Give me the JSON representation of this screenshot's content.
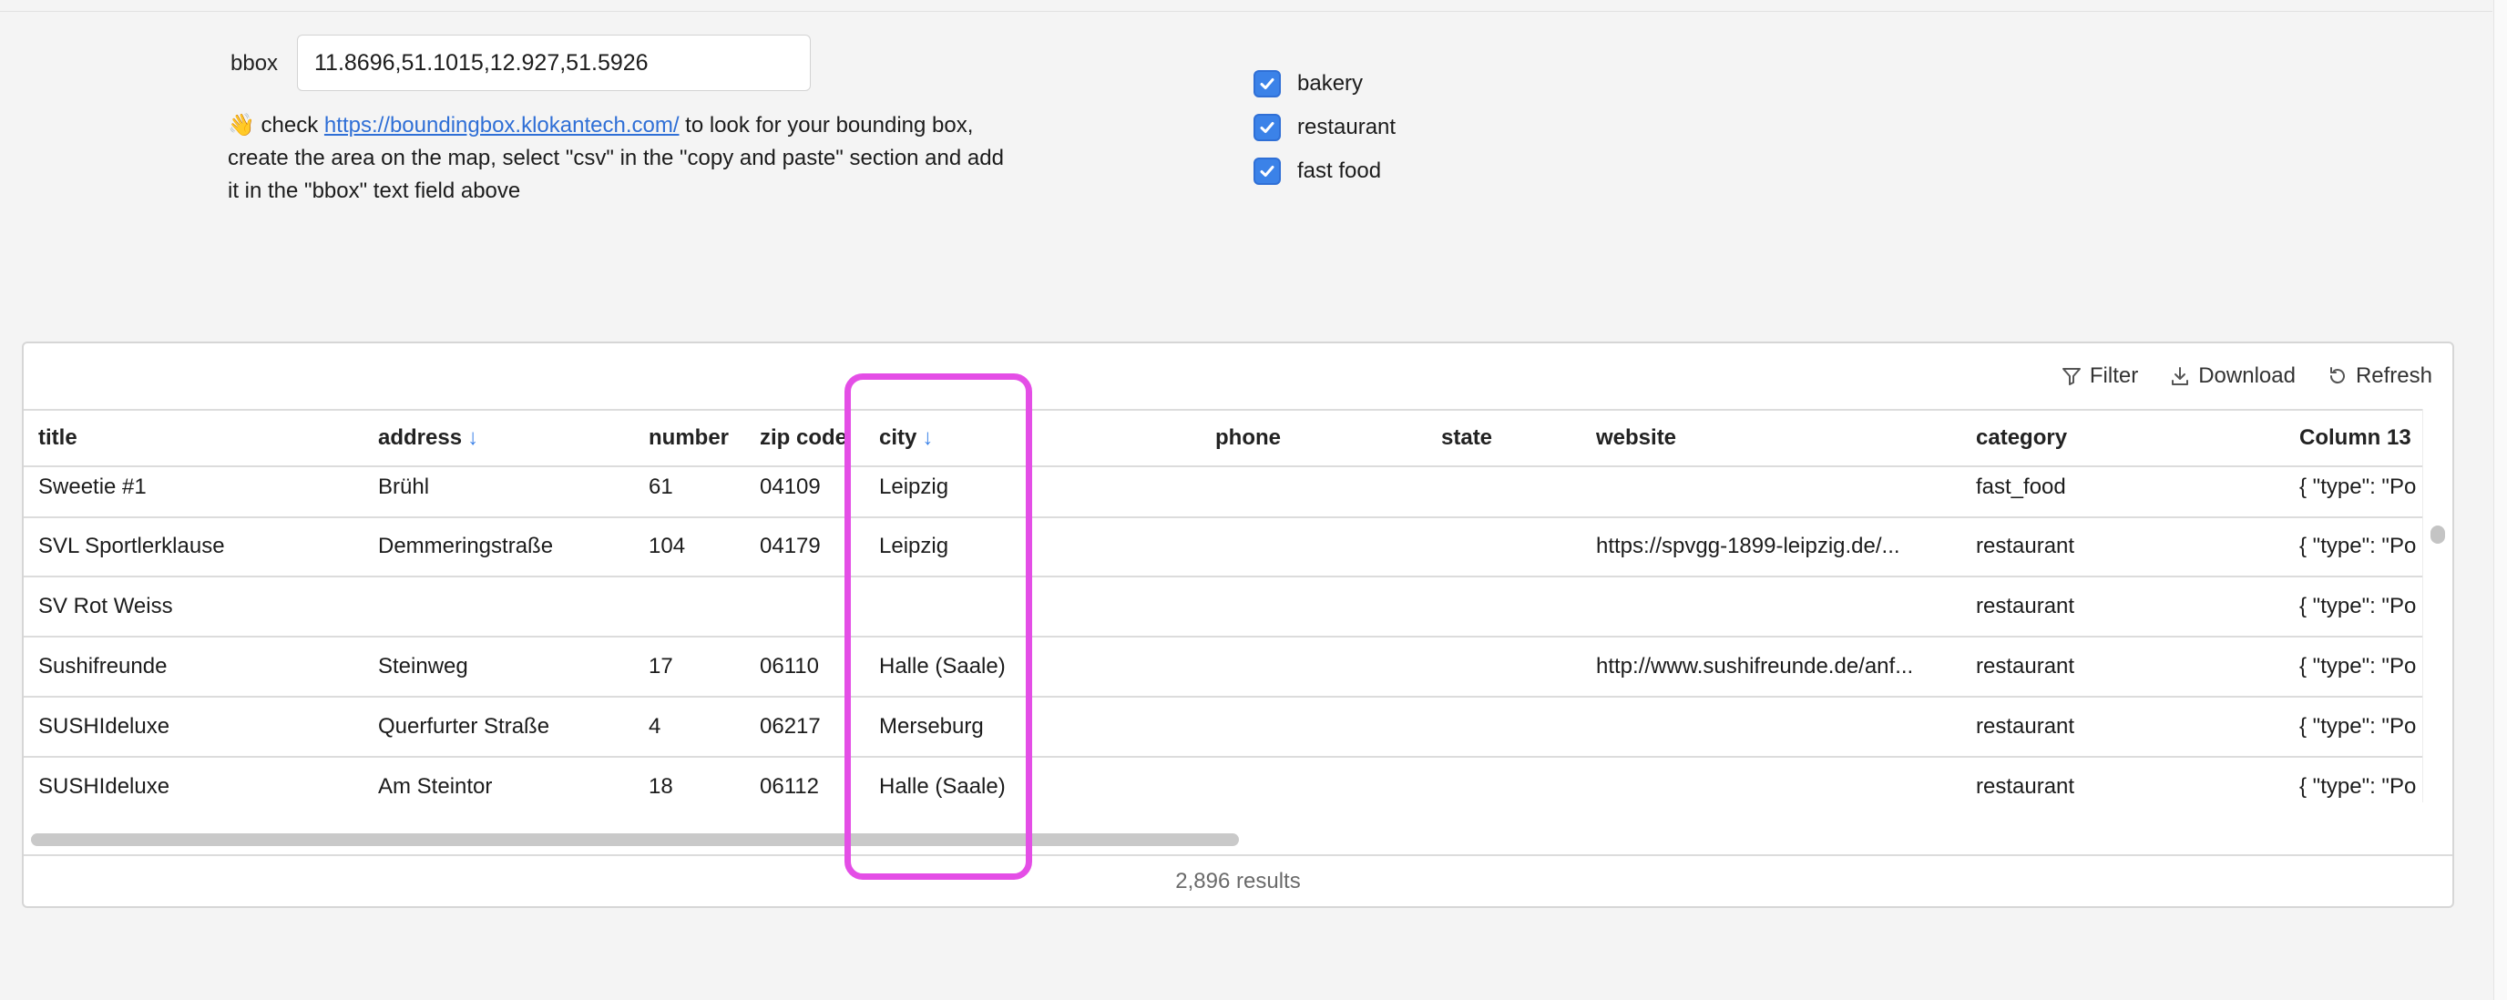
{
  "form": {
    "bbox_label": "bbox",
    "bbox_value": "11.8696,51.1015,12.927,51.5926",
    "help_emoji": "👋",
    "help_prefix": " check ",
    "help_link": "https://boundingbox.klokantech.com/",
    "help_suffix": " to look for your bounding box, create the area on the map, select \"csv\" in the \"copy and paste\" section and add it in the \"bbox\" text field above"
  },
  "filters": [
    {
      "label": "bakery",
      "checked": true
    },
    {
      "label": "restaurant",
      "checked": true
    },
    {
      "label": "fast food",
      "checked": true
    }
  ],
  "toolbar": {
    "filter": "Filter",
    "download": "Download",
    "refresh": "Refresh"
  },
  "table": {
    "columns": [
      "title",
      "address",
      "number",
      "zip code",
      "city",
      "phone",
      "state",
      "website",
      "category",
      "Column 13"
    ],
    "sorted_columns": [
      "address",
      "city"
    ],
    "rows": [
      [
        "Sweetie #1",
        "Brühl",
        "61",
        "04109",
        "Leipzig",
        "",
        "",
        "",
        "fast_food",
        "{ \"type\": \"Po"
      ],
      [
        "SVL Sportlerklause",
        "Demmeringstraße",
        "104",
        "04179",
        "Leipzig",
        "",
        "",
        "https://spvgg-1899-leipzig.de/...",
        "restaurant",
        "{ \"type\": \"Po"
      ],
      [
        "SV Rot Weiss",
        "",
        "",
        "",
        "",
        "",
        "",
        "",
        "restaurant",
        "{ \"type\": \"Po"
      ],
      [
        "Sushifreunde",
        "Steinweg",
        "17",
        "06110",
        "Halle (Saale)",
        "",
        "",
        "http://www.sushifreunde.de/anf...",
        "restaurant",
        "{ \"type\": \"Po"
      ],
      [
        "SUSHIdeluxe",
        "Querfurter Straße",
        "4",
        "06217",
        "Merseburg",
        "",
        "",
        "",
        "restaurant",
        "{ \"type\": \"Po"
      ],
      [
        "SUSHIdeluxe",
        "Am Steintor",
        "18",
        "06112",
        "Halle (Saale)",
        "",
        "",
        "",
        "restaurant",
        "{ \"type\": \"Po"
      ]
    ],
    "sort_arrow": "↓",
    "results": "2,896 results"
  },
  "colors": {
    "accent": "#3b82e8",
    "highlight": "#e44ee6"
  }
}
